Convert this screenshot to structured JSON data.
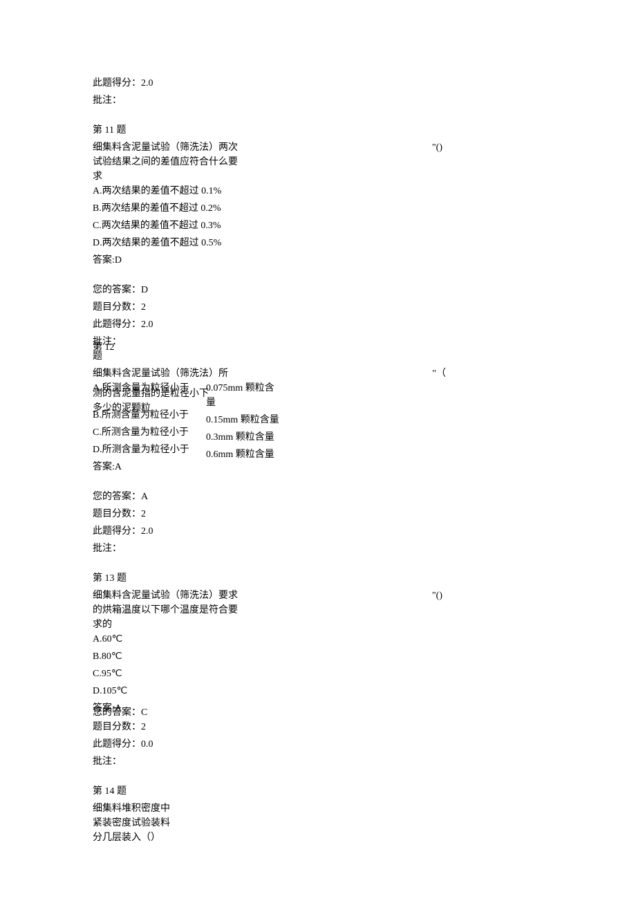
{
  "top": {
    "score_line": "此题得分：2.0",
    "comment_label": "批注："
  },
  "q11": {
    "heading": "第 11 题",
    "stem": "细集料含泥量试验（筛洗法）两次试验结果之间的差值应符合什么要求",
    "marker": "\"()",
    "opt_a": "A.两次结果的差值不超过 0.1%",
    "opt_b": "B.两次结果的差值不超过 0.2%",
    "opt_c": "C.两次结果的差值不超过 0.3%",
    "opt_d": "D.两次结果的差值不超过 0.5%",
    "answer_key": "答案:D",
    "your_answer": "您的答案：D",
    "max_score": "题目分数：2",
    "got_score": "此题得分：2.0",
    "comment_label": "批注：",
    "comment_under": "第 12",
    "heading12_under": "题"
  },
  "q12": {
    "stem_top": "细集料含泥量试验（筛洗法）所",
    "marker": "\"（",
    "left_line1_over": "A.所测含量为粒径小于",
    "left_line1_under": "测的含泥量指的是粒径小下多少的泥颗粒",
    "left_line2": "B.所测含量为粒径小于",
    "left_line3": "C.所测含量为粒径小于",
    "left_line4": "D.所测含量为粒径小于",
    "left_line5": "答案:A",
    "col2_line1": "0.075mm 颗粒含量",
    "col2_line2": "0.15mm 颗粒含量",
    "col2_line3": "0.3mm 颗粒含量",
    "col2_line4": "0.6mm 颗粒含量",
    "your_answer": "您的答案：A",
    "max_score": "题目分数：2",
    "got_score": "此题得分：2.0",
    "comment_label": "批注："
  },
  "q13": {
    "heading": "第 13 题",
    "stem": "细集料含泥量试验（筛洗法）要求的烘箱温度以下哪个温度是符合要求的",
    "marker": "\"()",
    "opt_a": "A.60℃",
    "opt_b": "B.80℃",
    "opt_c": "C.95℃",
    "opt_d": "D.105℃",
    "answer_key_over": "答案:A",
    "your_answer_under": "您的答案：C",
    "max_score": "题目分数：2",
    "got_score": "此题得分：0.0",
    "comment_label": "批注："
  },
  "q14": {
    "heading": "第 14 题",
    "stem": "细集料堆积密度中紧装密度试验装料分几层装入（）"
  }
}
